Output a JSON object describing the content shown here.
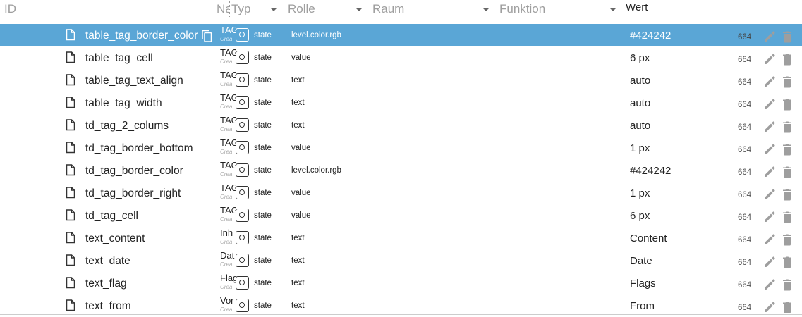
{
  "header": {
    "id_placeholder": "ID",
    "name_label": "Na",
    "type_label": "Typ",
    "role_label": "Rolle",
    "room_label": "Raum",
    "function_label": "Funktion",
    "value_label": "Wert"
  },
  "rows": [
    {
      "id": "table_tag_border_color",
      "name": "TAG",
      "sub": "Crea",
      "type": "state",
      "role": "level.color.rgb",
      "value": "#424242",
      "acl": "664",
      "selected": true
    },
    {
      "id": "table_tag_cell",
      "name": "TAG",
      "sub": "Crea",
      "type": "state",
      "role": "value",
      "value": "6 px",
      "acl": "664"
    },
    {
      "id": "table_tag_text_align",
      "name": "TAG",
      "sub": "Crea",
      "type": "state",
      "role": "text",
      "value": "auto",
      "acl": "664"
    },
    {
      "id": "table_tag_width",
      "name": "TAG",
      "sub": "Crea",
      "type": "state",
      "role": "text",
      "value": "auto",
      "acl": "664"
    },
    {
      "id": "td_tag_2_colums",
      "name": "TAG",
      "sub": "Crea",
      "type": "state",
      "role": "text",
      "value": "auto",
      "acl": "664"
    },
    {
      "id": "td_tag_border_bottom",
      "name": "TAG",
      "sub": "Crea",
      "type": "state",
      "role": "value",
      "value": "1 px",
      "acl": "664"
    },
    {
      "id": "td_tag_border_color",
      "name": "TAG",
      "sub": "Crea",
      "type": "state",
      "role": "level.color.rgb",
      "value": "#424242",
      "acl": "664"
    },
    {
      "id": "td_tag_border_right",
      "name": "TAG",
      "sub": "Crea",
      "type": "state",
      "role": "value",
      "value": "1 px",
      "acl": "664"
    },
    {
      "id": "td_tag_cell",
      "name": "TAG",
      "sub": "Crea",
      "type": "state",
      "role": "value",
      "value": "6 px",
      "acl": "664"
    },
    {
      "id": "text_content",
      "name": "Inh",
      "sub": "Crea",
      "type": "state",
      "role": "text",
      "value": "Content",
      "acl": "664"
    },
    {
      "id": "text_date",
      "name": "Dat",
      "sub": "Crea",
      "type": "state",
      "role": "text",
      "value": "Date",
      "acl": "664"
    },
    {
      "id": "text_flag",
      "name": "Flag",
      "sub": "Crea",
      "type": "state",
      "role": "text",
      "value": "Flags",
      "acl": "664"
    },
    {
      "id": "text_from",
      "name": "Vor",
      "sub": "Crea",
      "type": "state",
      "role": "text",
      "value": "From",
      "acl": "664"
    }
  ],
  "icons": {
    "row_file": "file-icon",
    "copy": "copy-icon",
    "type": "state-type-icon",
    "edit": "pencil-icon",
    "delete": "trash-icon"
  },
  "colors": {
    "selected_row": "#5aa6d6",
    "icon_gray": "#9e9e9e"
  }
}
